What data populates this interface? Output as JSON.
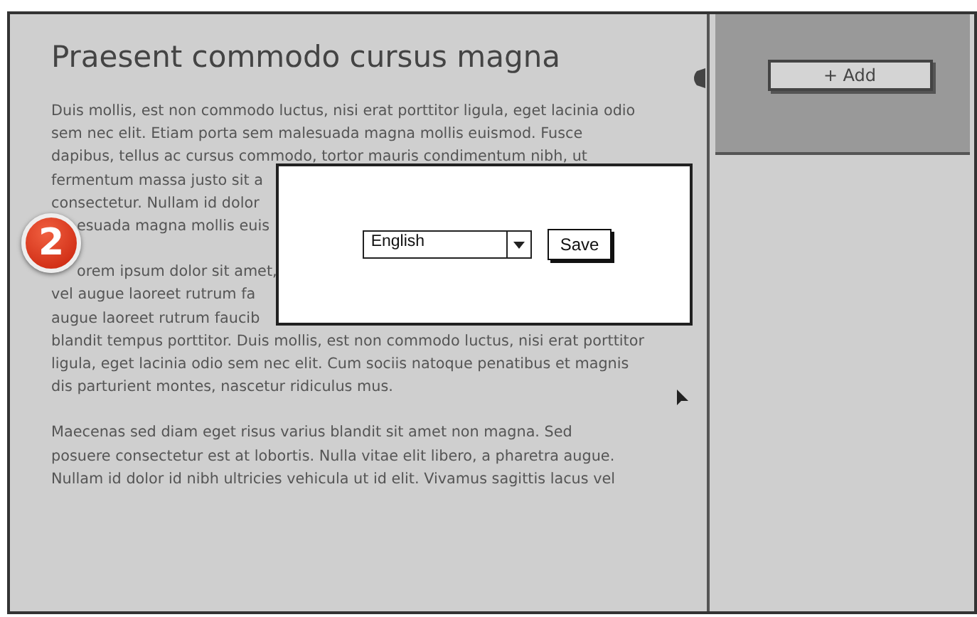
{
  "main": {
    "heading": "Praesent commodo cursus magna",
    "paragraphs": [
      {
        "lines": [
          {
            "kind": "full",
            "text": "Duis mollis, est non commodo luctus, nisi erat porttitor ligula, eget lacinia odio"
          },
          {
            "kind": "full",
            "text": "sem nec elit. Etiam porta sem malesuada magna mollis euismod. Fusce"
          },
          {
            "kind": "full",
            "text": "dapibus, tellus ac cursus commodo, tortor mauris condimentum nibh, ut"
          },
          {
            "kind": "full",
            "text": "fermentum massa justo sit a"
          },
          {
            "kind": "full",
            "text": "consectetur. Nullam id dolor"
          },
          {
            "kind": "partly_hidden",
            "text": "esuada magna mollis euis"
          }
        ]
      },
      {
        "lines": [
          {
            "kind": "partly_hidden",
            "text": "orem ipsum dolor sit amet,"
          },
          {
            "kind": "full",
            "text": "vel augue laoreet rutrum fa"
          },
          {
            "kind": "full",
            "text": "augue laoreet rutrum faucib"
          },
          {
            "kind": "full",
            "text": "blandit tempus porttitor. Duis mollis, est non commodo luctus, nisi erat porttitor"
          },
          {
            "kind": "full",
            "text": "ligula, eget lacinia odio sem nec elit. Cum sociis natoque penatibus et magnis"
          },
          {
            "kind": "full",
            "text": "dis parturient montes, nascetur ridiculus mus."
          }
        ]
      },
      {
        "lines": [
          {
            "kind": "full",
            "text": "Maecenas sed diam eget risus varius blandit sit amet non magna. Sed"
          },
          {
            "kind": "full",
            "text": "posuere consectetur est at lobortis. Nulla vitae elit libero, a pharetra augue."
          },
          {
            "kind": "full",
            "text": "Nullam id dolor id nibh ultricies vehicula ut id elit. Vivamus sagittis lacus vel"
          }
        ]
      }
    ]
  },
  "step_badge": "2",
  "sidebar": {
    "add_button": "+ Add"
  },
  "dialog": {
    "language_select": {
      "value": "English"
    },
    "save_button": "Save"
  }
}
